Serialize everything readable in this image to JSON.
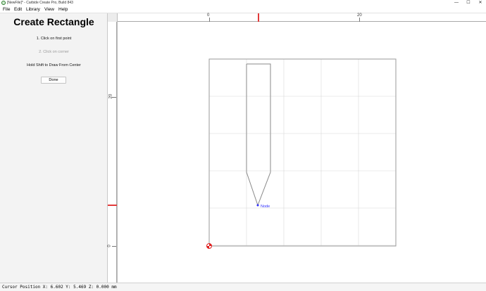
{
  "window": {
    "title": "[NewFile]* - Carbide Create Pro, Build 843",
    "icon": "carbide-create-app-icon",
    "controls": {
      "minimize": "—",
      "maximize": "☐",
      "close": "✕"
    }
  },
  "menu": {
    "items": [
      {
        "label": "File"
      },
      {
        "label": "Edit"
      },
      {
        "label": "Library"
      },
      {
        "label": "View"
      },
      {
        "label": "Help"
      }
    ]
  },
  "panel": {
    "title": "Create Rectangle",
    "step1": "1. Click on first point",
    "step2": "2. Click on corner",
    "hint": "Hold Shift to Draw From Center",
    "done_label": "Done"
  },
  "rulers": {
    "horizontal_labels": [
      "0",
      "20"
    ],
    "vertical_labels": [
      "20",
      "0"
    ]
  },
  "canvas": {
    "node_label": "Node",
    "colors": {
      "grid": "#d8d8d8",
      "stock_border": "#9a9a9a",
      "shape": "#8a8a8a",
      "node": "#3030ff",
      "origin_red": "#e02020",
      "cursor_red": "#e23a3a"
    }
  },
  "status": {
    "text": "Cursor Position X: 6.602 Y: 5.469 Z: 0.000 mm"
  }
}
